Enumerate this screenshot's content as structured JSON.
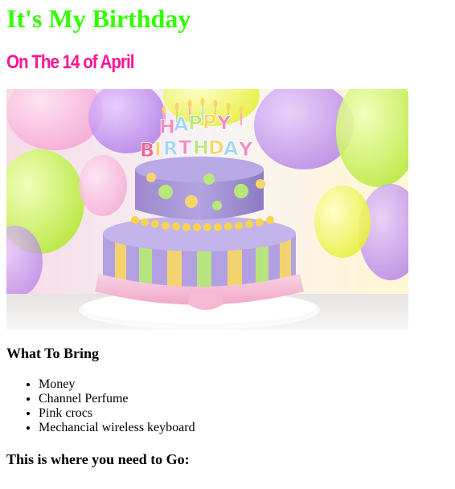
{
  "page": {
    "title": "It's My Birthday",
    "subtitle": "On The 14 of April",
    "image": {
      "alt": "birthday cake image",
      "cake_lettering": "HAPPY BIRTHDAY"
    },
    "bring": {
      "heading": "What To Bring",
      "items": [
        "Money",
        "Channel Perfume",
        "Pink crocs",
        "Mechancial wireless keyboard"
      ]
    },
    "location": {
      "heading": "This is where you need to Go:"
    }
  },
  "colors": {
    "title": "#33ff00",
    "subtitle": "#ff1493"
  }
}
